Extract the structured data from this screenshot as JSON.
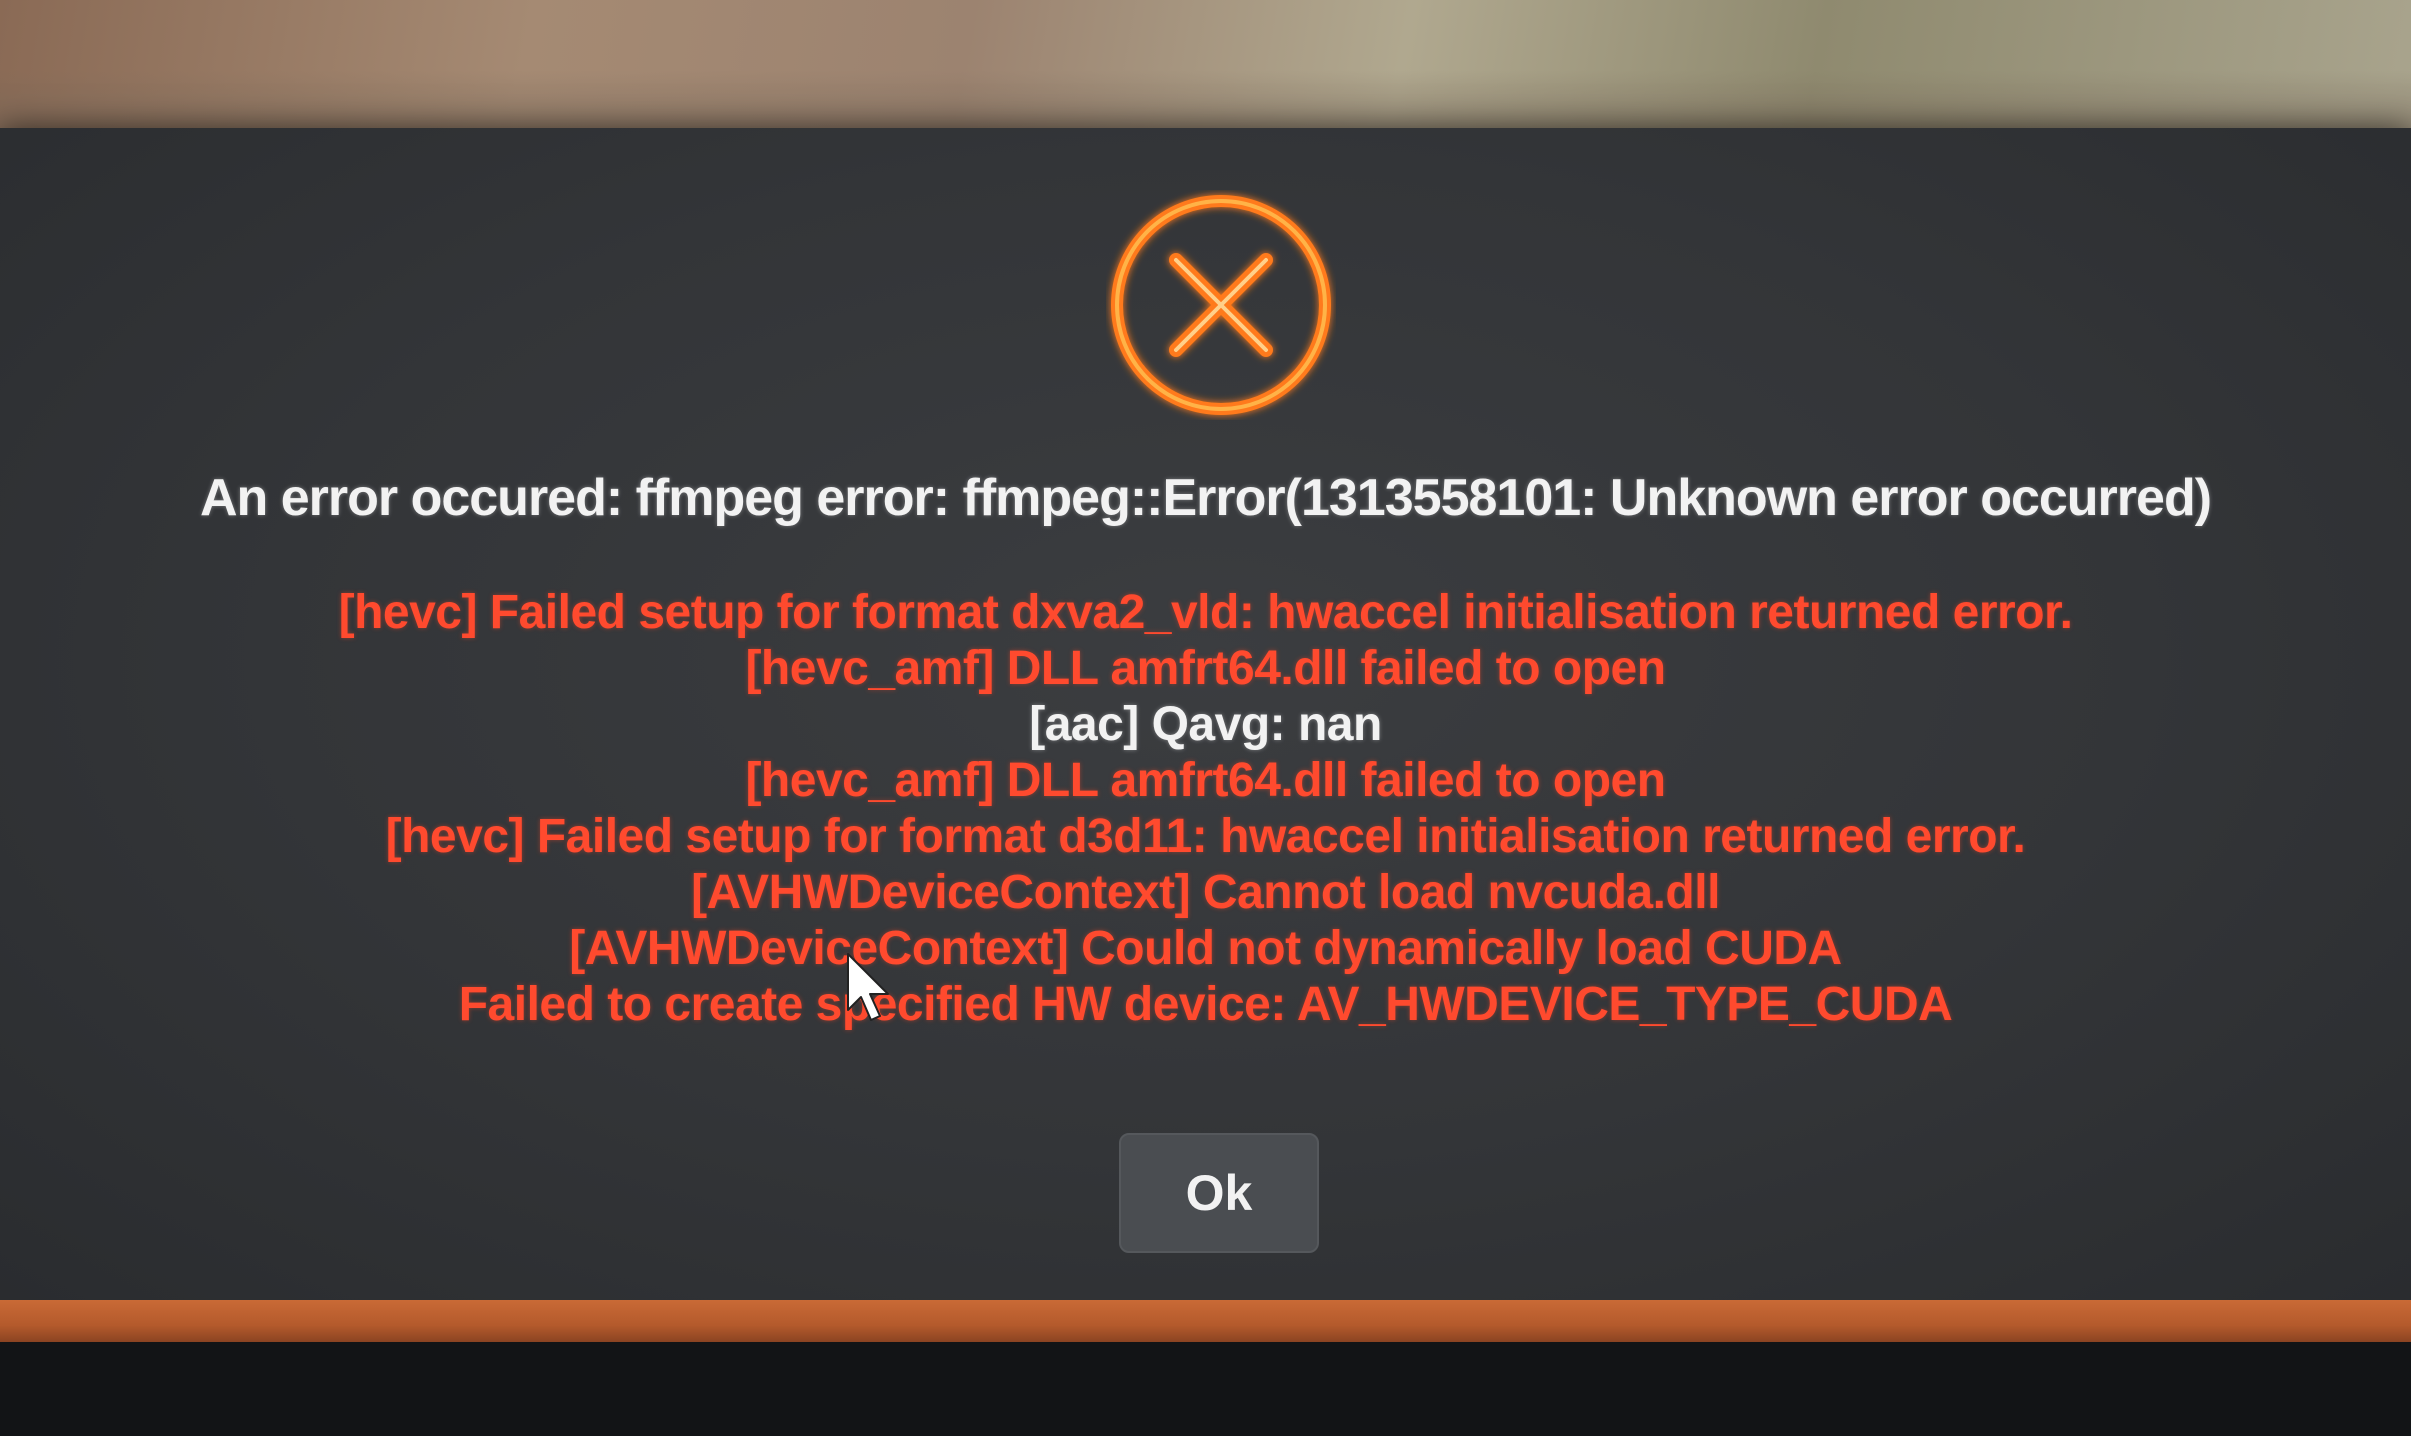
{
  "dialog": {
    "title": "An error occured: ffmpeg error: ffmpeg::Error(1313558101: Unknown error occurred)",
    "messages": [
      {
        "text": "[hevc] Failed setup for format dxva2_vld: hwaccel initialisation returned error.",
        "kind": "error"
      },
      {
        "text": "[hevc_amf] DLL amfrt64.dll failed to open",
        "kind": "error"
      },
      {
        "text": "[aac] Qavg: nan",
        "kind": "info"
      },
      {
        "text": "[hevc_amf] DLL amfrt64.dll failed to open",
        "kind": "error"
      },
      {
        "text": "[hevc] Failed setup for format d3d11: hwaccel initialisation returned error.",
        "kind": "error"
      },
      {
        "text": "[AVHWDeviceContext] Cannot load nvcuda.dll",
        "kind": "error"
      },
      {
        "text": "[AVHWDeviceContext] Could not dynamically load CUDA",
        "kind": "error"
      },
      {
        "text": "Failed to create specified HW device: AV_HWDEVICE_TYPE_CUDA",
        "kind": "error"
      }
    ],
    "ok_label": "Ok",
    "icon": "error-circle-x-icon"
  },
  "colors": {
    "error_text": "#ff4a2e",
    "info_text": "#f2f2f2",
    "icon_orange": "#ff7a1a",
    "dialog_bg": "#333538",
    "button_bg": "#4a4d51",
    "accent_strip": "#c96a36"
  }
}
